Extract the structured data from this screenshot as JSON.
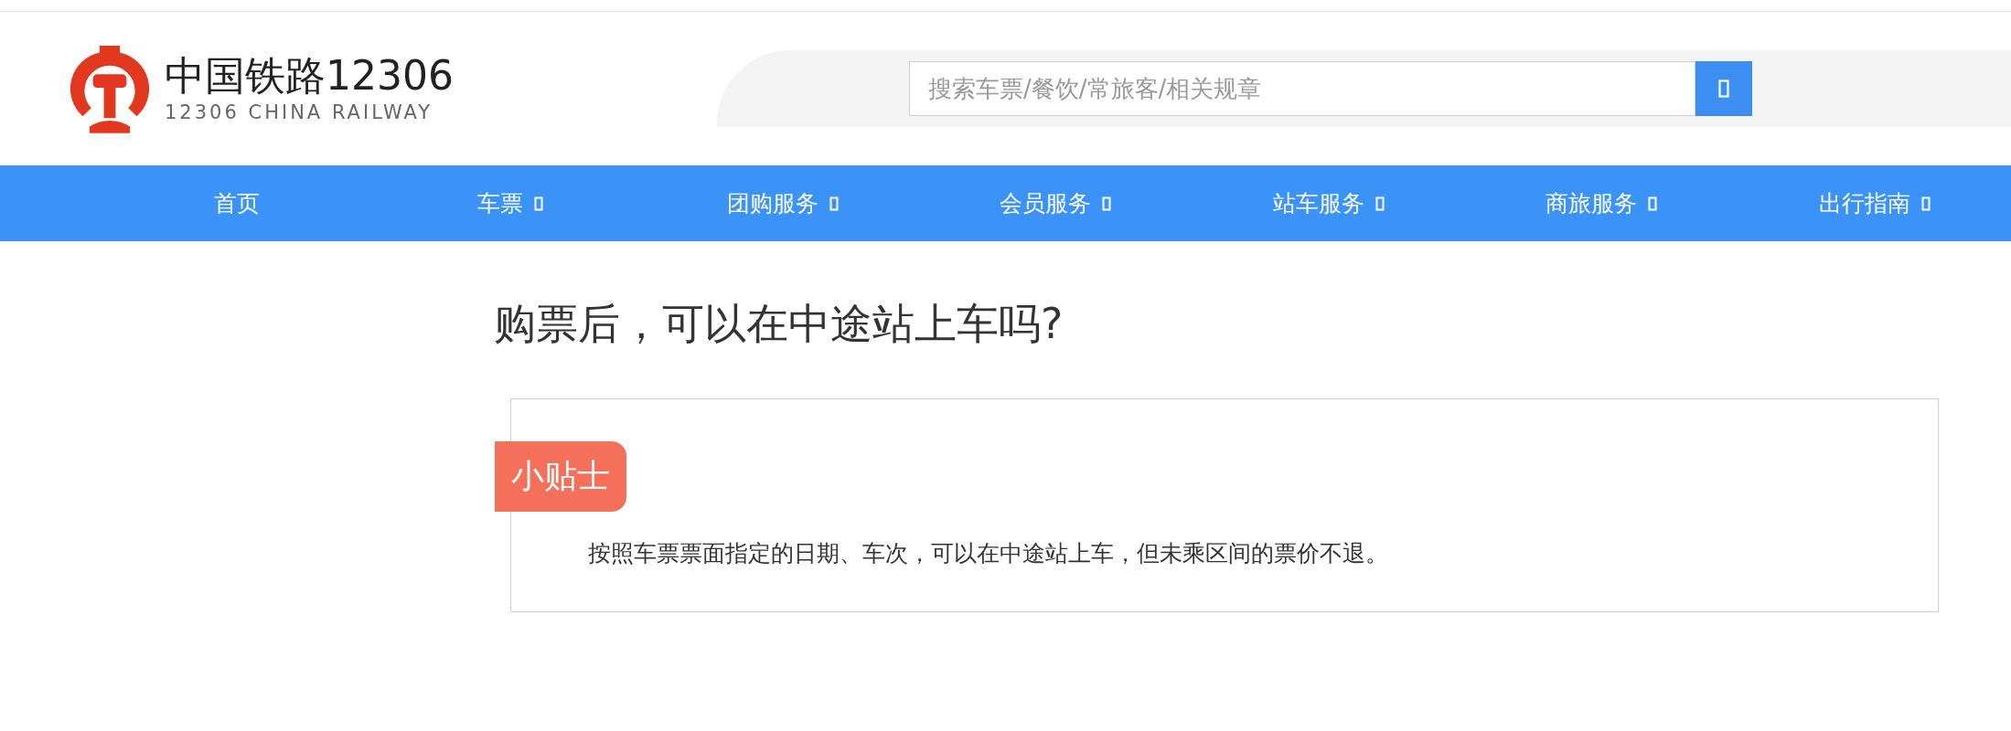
{
  "header": {
    "logo_title": "中国铁路12306",
    "logo_subtitle": "12306 CHINA RAILWAY",
    "search": {
      "placeholder": "搜索车票/餐饮/常旅客/相关规章"
    }
  },
  "nav": [
    {
      "label": "首页",
      "has_dropdown": false
    },
    {
      "label": "车票",
      "has_dropdown": true
    },
    {
      "label": "团购服务",
      "has_dropdown": true
    },
    {
      "label": "会员服务",
      "has_dropdown": true
    },
    {
      "label": "站车服务",
      "has_dropdown": true
    },
    {
      "label": "商旅服务",
      "has_dropdown": true
    },
    {
      "label": "出行指南",
      "has_dropdown": true
    }
  ],
  "question": "购票后，可以在中途站上车吗?",
  "tip": {
    "tag": "小贴士",
    "text": "按照车票票面指定的日期、车次，可以在中途站上车，但未乘区间的票价不退。"
  }
}
